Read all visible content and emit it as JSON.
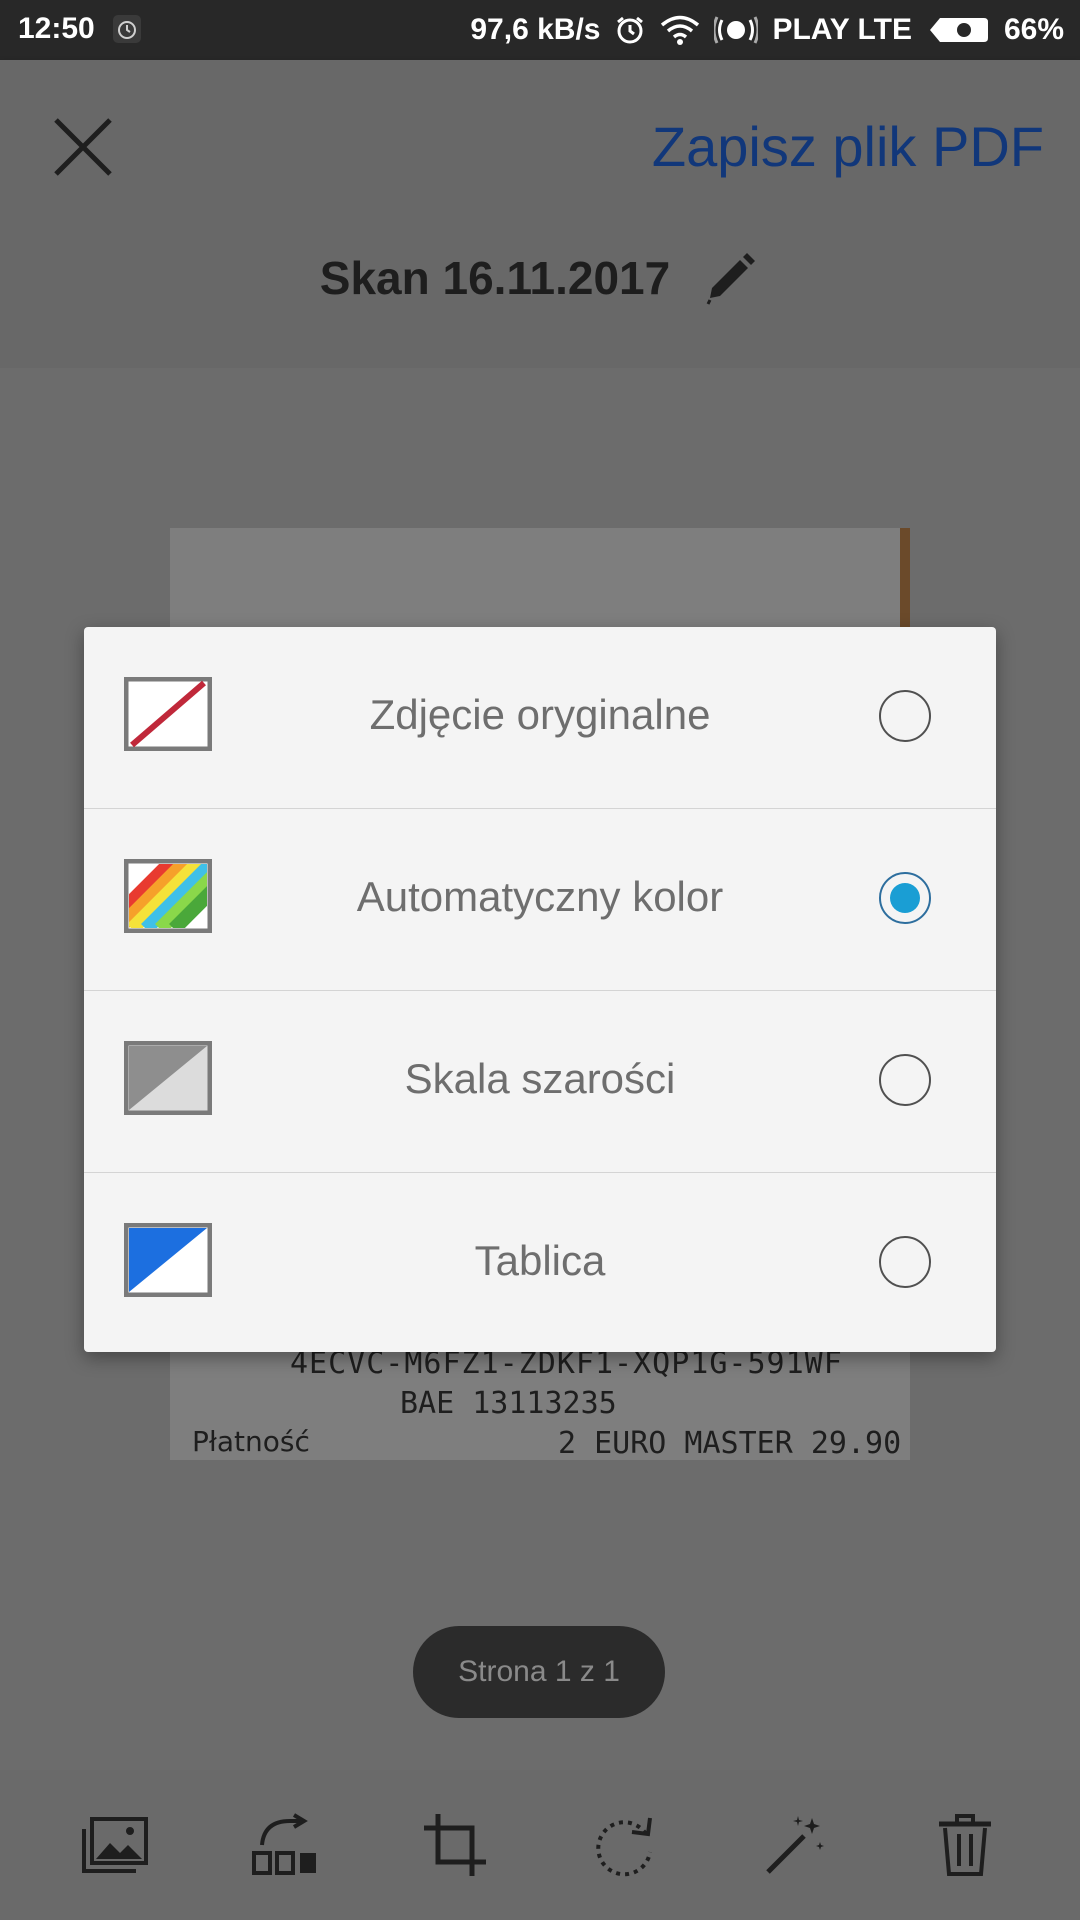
{
  "status_bar": {
    "time": "12:50",
    "network_speed": "97,6 kB/s",
    "carrier": "PLAY LTE",
    "battery": "66%"
  },
  "header": {
    "save_label": "Zapisz plik PDF",
    "document_title": "Skan 16.11.2017"
  },
  "receipt": {
    "line1": "4ECVC-M6FZ1-ZDKF1-XQP1G-591WF",
    "line2": "BAE 13113235",
    "line3_left": "Płatność",
    "line3_right": "2 EURO MASTER 29.90"
  },
  "page_indicator": "Strona 1 z 1",
  "color_options": [
    {
      "label": "Zdjęcie oryginalne",
      "icon": "original-photo-icon",
      "selected": false
    },
    {
      "label": "Automatyczny kolor",
      "icon": "auto-color-icon",
      "selected": true
    },
    {
      "label": "Skala szarości",
      "icon": "grayscale-icon",
      "selected": false
    },
    {
      "label": "Tablica",
      "icon": "whiteboard-icon",
      "selected": false
    }
  ],
  "toolbar": [
    {
      "icon": "gallery-icon"
    },
    {
      "icon": "reorder-icon"
    },
    {
      "icon": "crop-icon"
    },
    {
      "icon": "rotate-icon"
    },
    {
      "icon": "magic-wand-icon"
    },
    {
      "icon": "trash-icon"
    }
  ],
  "colors": {
    "accent": "#1a9ed4",
    "save_link": "#11377a",
    "dialog_bg": "#f4f4f4",
    "scrim": "#6c6c6c"
  }
}
